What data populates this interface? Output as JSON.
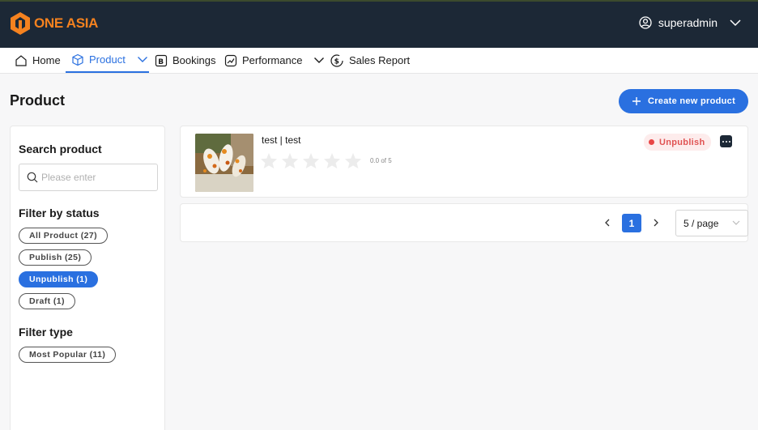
{
  "brand": {
    "name": "ONE ASIA",
    "color": "#f5821f"
  },
  "header": {
    "user_name": "superadmin",
    "background": "#1c2836"
  },
  "nav": {
    "items": [
      {
        "label": "Home",
        "icon": "home-icon"
      },
      {
        "label": "Product",
        "icon": "box-icon",
        "active": true
      },
      {
        "label": "Bookings",
        "icon": "bookings-icon"
      },
      {
        "label": "Performance",
        "icon": "performance-icon"
      },
      {
        "label": "Sales Report",
        "icon": "sales-report-icon"
      }
    ],
    "accent": "#2a70e0"
  },
  "page": {
    "title": "Product",
    "create_button": "Create new product"
  },
  "sidebar": {
    "search_heading": "Search product",
    "search_placeholder": "Please enter",
    "status_heading": "Filter by status",
    "status_filters": [
      {
        "label": "All Product (27)"
      },
      {
        "label": "Publish (25)"
      },
      {
        "label": "Unpublish (1)",
        "active": true
      },
      {
        "label": "Draft (1)"
      }
    ],
    "type_heading": "Filter type",
    "type_filters": [
      {
        "label": "Most Popular (11)"
      }
    ]
  },
  "products": [
    {
      "name": "test | test",
      "rating": 0.0,
      "rating_max": 5,
      "rating_text": "0.0 of 5",
      "status": "Unpublish",
      "status_color": "#e84545"
    }
  ],
  "pagination": {
    "current_page": "1",
    "page_size": "5 / page"
  }
}
